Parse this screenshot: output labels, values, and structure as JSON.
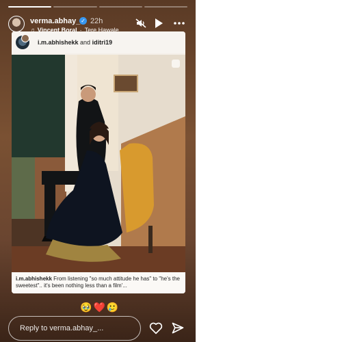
{
  "header": {
    "username": "verma.abhay_",
    "time": "22h",
    "music_artist": "Vincent Boral",
    "music_separator": "·",
    "music_title": "Tere Hawale"
  },
  "card": {
    "author1": "i.m.abhishekk",
    "joiner": "and",
    "author2": "iditri19",
    "caption_user": "i.m.abhishekk",
    "caption_text": "From listening \"so much attitude he has\" to \"he's the sweetest\".. it's been nothing less than a film'..."
  },
  "reactions": [
    "🥹",
    "❤️",
    "🥲"
  ],
  "reply": {
    "placeholder": "Reply to verma.abhay_..."
  },
  "colors": {
    "verified": "#3897f0"
  }
}
